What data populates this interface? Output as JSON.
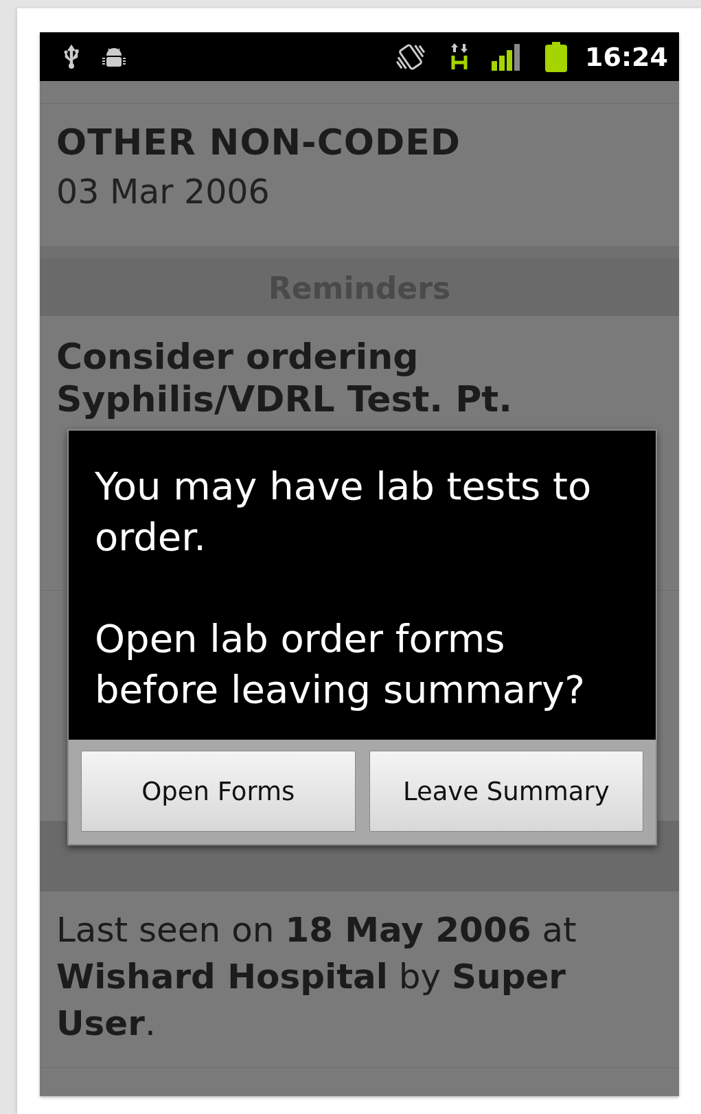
{
  "status_bar": {
    "time": "16:24"
  },
  "encounter": {
    "title": "OTHER NON-CODED",
    "date": "03 Mar 2006"
  },
  "reminders": {
    "heading": "Reminders",
    "items": [
      {
        "text": "Consider ordering Syphilis/VDRL Test. Pt."
      }
    ]
  },
  "notes": {
    "text": "Last seen on **18 May 2006** at **Wishard Hospital** by **Super User**."
  },
  "dialog": {
    "message": [
      "You may have lab tests to order.",
      "Open lab order forms before leaving summary?"
    ],
    "buttons": [
      "Open Forms",
      "Leave Summary"
    ]
  }
}
